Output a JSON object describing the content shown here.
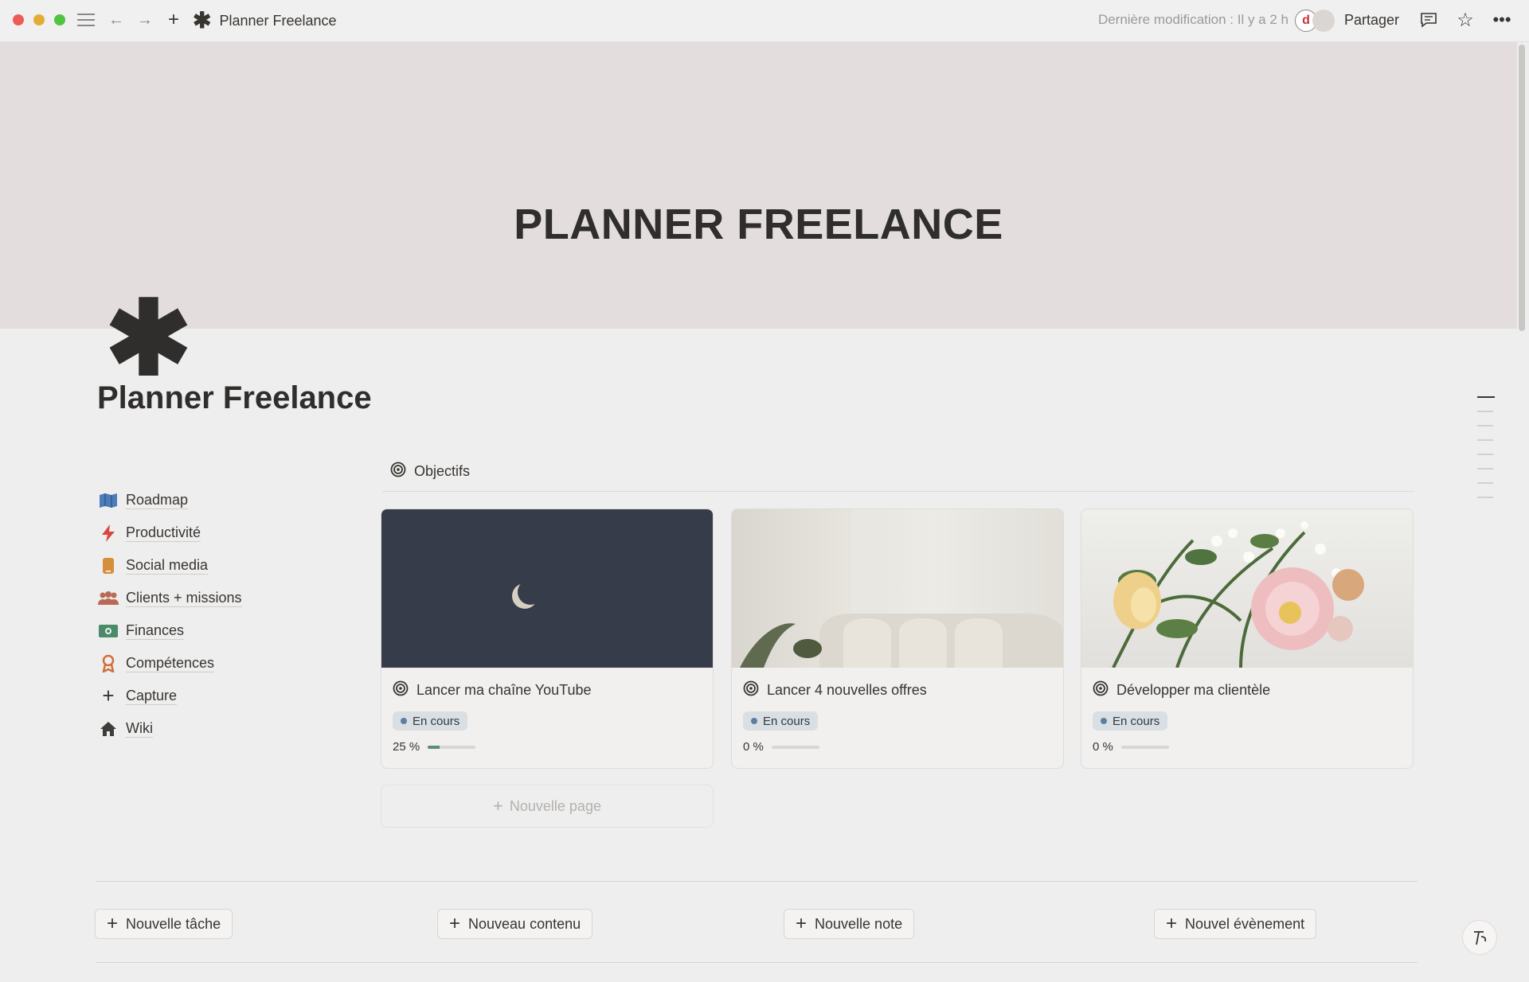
{
  "topbar": {
    "page_name": "Planner Freelance",
    "last_modified": "Dernière modification : Il y a 2 h",
    "avatar_letter": "d",
    "share_label": "Partager"
  },
  "banner": {
    "title": "PLANNER FREELANCE"
  },
  "page": {
    "icon": "✱",
    "title": "Planner Freelance"
  },
  "nav": [
    {
      "label": "Roadmap",
      "icon": "map-icon"
    },
    {
      "label": "Productivité",
      "icon": "lightning-icon"
    },
    {
      "label": "Social media",
      "icon": "phone-icon"
    },
    {
      "label": "Clients + missions",
      "icon": "people-icon"
    },
    {
      "label": "Finances",
      "icon": "money-icon"
    },
    {
      "label": "Compétences",
      "icon": "award-icon"
    },
    {
      "label": "Capture",
      "icon": "plus-icon"
    },
    {
      "label": "Wiki",
      "icon": "home-icon"
    }
  ],
  "objectives": {
    "header": "Objectifs",
    "cards": [
      {
        "title": "Lancer ma chaîne YouTube",
        "status": "En cours",
        "progress_label": "25 %",
        "progress": 0.25
      },
      {
        "title": "Lancer 4 nouvelles offres",
        "status": "En cours",
        "progress_label": "0 %",
        "progress": 0
      },
      {
        "title": "Développer ma clientèle",
        "status": "En cours",
        "progress_label": "0 %",
        "progress": 0
      }
    ],
    "new_page_label": "Nouvelle page"
  },
  "actions": {
    "new_task": "Nouvelle tâche",
    "new_content": "Nouveau contenu",
    "new_note": "Nouvelle note",
    "new_event": "Nouvel évènement"
  },
  "colors": {
    "status_badge_bg": "#d9dfe3",
    "status_dot": "#5b7fa0",
    "progress_fill": "#5a8d7f"
  }
}
